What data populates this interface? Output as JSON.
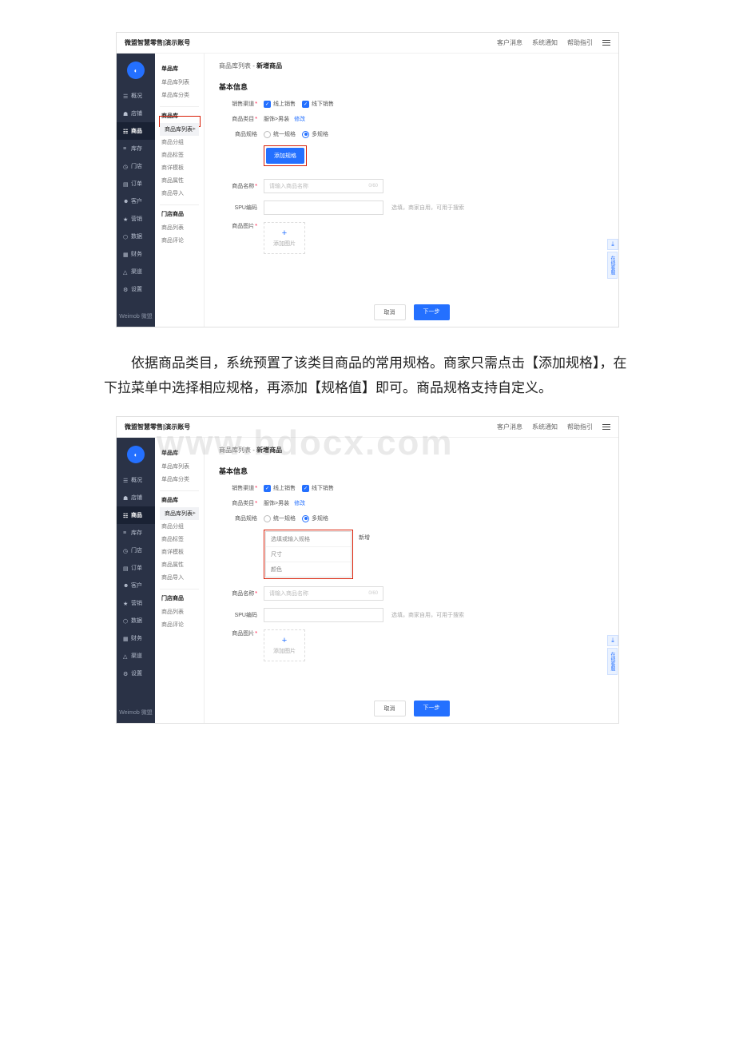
{
  "topbar": {
    "title": "微盟智慧零售|演示账号",
    "links": [
      "客户消息",
      "系统通知",
      "帮助指引"
    ]
  },
  "sidebar": {
    "items": [
      {
        "icon": "overview",
        "label": "概况"
      },
      {
        "icon": "store",
        "label": "店铺"
      },
      {
        "icon": "goods",
        "label": "商品"
      },
      {
        "icon": "stock",
        "label": "库存"
      },
      {
        "icon": "shop",
        "label": "门店"
      },
      {
        "icon": "order",
        "label": "订单"
      },
      {
        "icon": "customer",
        "label": "客户"
      },
      {
        "icon": "marketing",
        "label": "营销"
      },
      {
        "icon": "data",
        "label": "数据"
      },
      {
        "icon": "finance",
        "label": "财务"
      },
      {
        "icon": "channel",
        "label": "渠道"
      },
      {
        "icon": "setting",
        "label": "设置"
      }
    ],
    "footer": "Weimob 微盟"
  },
  "subside": {
    "g1": {
      "title": "单品库",
      "items": [
        "单品库列表",
        "单品库分类"
      ]
    },
    "g2": {
      "title": "商品库",
      "items": [
        "商品库列表",
        "商品分组",
        "商品标签",
        "商详模板",
        "商品属性",
        "商品导入"
      ]
    },
    "g3": {
      "title": "门店商品",
      "items": [
        "商品列表",
        "商品评论"
      ]
    }
  },
  "breadcrumb": {
    "a": "商品库列表",
    "sep": " - ",
    "b": "新增商品"
  },
  "sectionTitle": "基本信息",
  "form": {
    "salesChannel": {
      "label": "销售渠道",
      "opt1": "线上销售",
      "opt2": "线下销售"
    },
    "category": {
      "label": "商品类目",
      "path": "服饰>男装",
      "modify": "修改"
    },
    "spec": {
      "label": "商品规格",
      "opt1": "统一规格",
      "opt2": "多规格",
      "addBtn": "添加规格"
    },
    "name": {
      "label": "商品名称",
      "placeholder": "请输入商品名称",
      "counter": "0/60"
    },
    "spu": {
      "label": "SPU编码",
      "hint": "选填，商家自用，可用于搜索"
    },
    "img": {
      "label": "商品图片",
      "add": "添加图片"
    }
  },
  "footer": {
    "cancel": "取消",
    "next": "下一步"
  },
  "float": {
    "download": "⤓",
    "txt": "在线客服"
  },
  "descr": "依据商品类目，系统预置了该类目商品的常用规格。商家只需点击【添加规格】，在下拉菜单中选择相应规格，再添加【规格值】即可。商品规格支持自定义。",
  "dropdown": {
    "placeholder": "选填或输入规格",
    "add": "新增",
    "opt1": "尺寸",
    "opt2": "颜色"
  },
  "watermark": "www.bdocx.com"
}
